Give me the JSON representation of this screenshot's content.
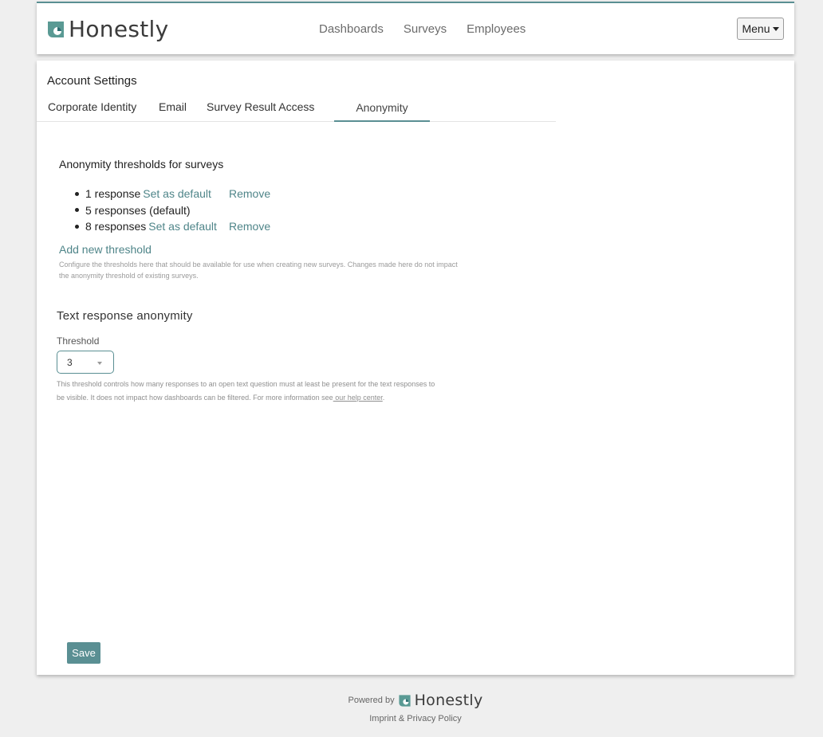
{
  "brand": {
    "name": "Honestly",
    "accent": "#5a8f93",
    "logo_color": "#4f8a8f"
  },
  "nav": {
    "links": [
      "Dashboards",
      "Surveys",
      "Employees"
    ],
    "menu_label": "Menu"
  },
  "page": {
    "title": "Account Settings",
    "tabs": [
      "Corporate Identity",
      "Email",
      "Survey Result Access",
      "Anonymity"
    ],
    "active_tab": "Anonymity"
  },
  "anonymity": {
    "section_title": "Anonymity thresholds for surveys",
    "thresholds": [
      {
        "label": "1 response",
        "set_default": "Set as default",
        "remove": "Remove"
      },
      {
        "label": "5 responses (default)"
      },
      {
        "label": "8 responses",
        "set_default": "Set as default",
        "remove": "Remove"
      }
    ],
    "add_link": "Add new threshold",
    "help": "Configure the thresholds here that should be available for use when creating new surveys. Changes made here do not impact the anonymity threshold of existing surveys."
  },
  "text_response": {
    "heading": "Text response anonymity",
    "label": "Threshold",
    "value": "3",
    "help_prefix": "This threshold controls how many responses to an open text question must at least be present for the text responses to be visible. It does not impact how dashboards can be filtered. For more information see",
    "help_link": " our help center",
    "help_suffix": "."
  },
  "actions": {
    "save": "Save"
  },
  "footer": {
    "powered_by": "Powered by",
    "brand": "Honestly",
    "imprint": "Imprint & Privacy Policy"
  }
}
